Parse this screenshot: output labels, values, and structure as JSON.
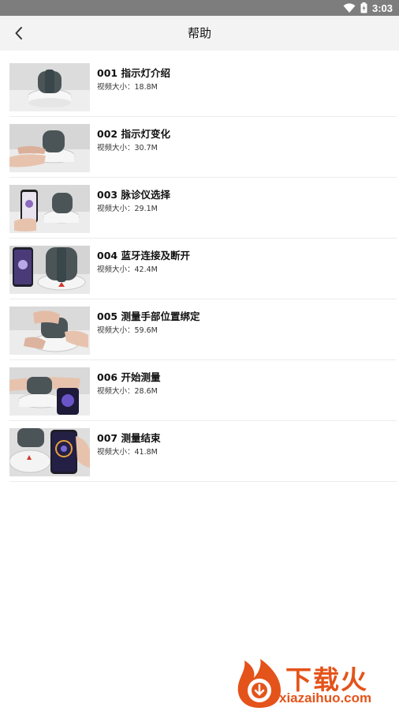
{
  "status_bar": {
    "time": "3:03"
  },
  "header": {
    "title": "帮助"
  },
  "videos": [
    {
      "title": "001 指示灯介绍",
      "size": "视频大小：18.8M"
    },
    {
      "title": "002 指示灯变化",
      "size": "视频大小：30.7M"
    },
    {
      "title": "003 脉诊仪选择",
      "size": "视频大小：29.1M"
    },
    {
      "title": "004 蓝牙连接及断开",
      "size": "视频大小：42.4M"
    },
    {
      "title": "005 测量手部位置绑定",
      "size": "视频大小：59.6M"
    },
    {
      "title": "006 开始测量",
      "size": "视频大小：28.6M"
    },
    {
      "title": "007 测量结束",
      "size": "视频大小：41.8M"
    }
  ],
  "watermark": {
    "brand": "下载火",
    "url": "xiazaihuo.com"
  },
  "colors": {
    "status_bar": "#7d7d7d",
    "app_bar": "#f3f3f3",
    "watermark": "#e4531a"
  }
}
